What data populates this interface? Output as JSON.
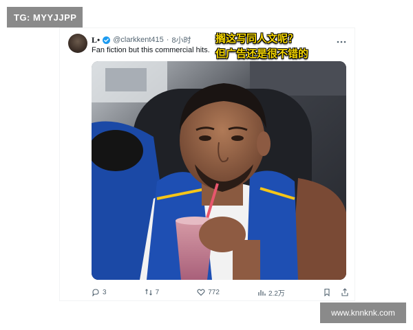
{
  "corner_tag": "TG: MYYJJPP",
  "tweet": {
    "brand": "L•",
    "handle": "@clarkkent415",
    "separator": "·",
    "time": "8小时",
    "text": "Fan fiction but this commercial hits.",
    "more_icon": "ellipsis-icon"
  },
  "overlay_caption": {
    "line1": "搁这写同人文呢？",
    "line2": "但广告还是很不错的"
  },
  "media": {
    "description_icon": "photo"
  },
  "actions": {
    "replies": "3",
    "retweets": "7",
    "likes": "772",
    "views": "2.2万"
  },
  "watermark": "www.knnknk.com",
  "colors": {
    "caption_yellow": "#f7d800",
    "verified_blue": "#1d9bf0",
    "muted_text": "#536471",
    "badge_gray": "#8a8a8a"
  }
}
